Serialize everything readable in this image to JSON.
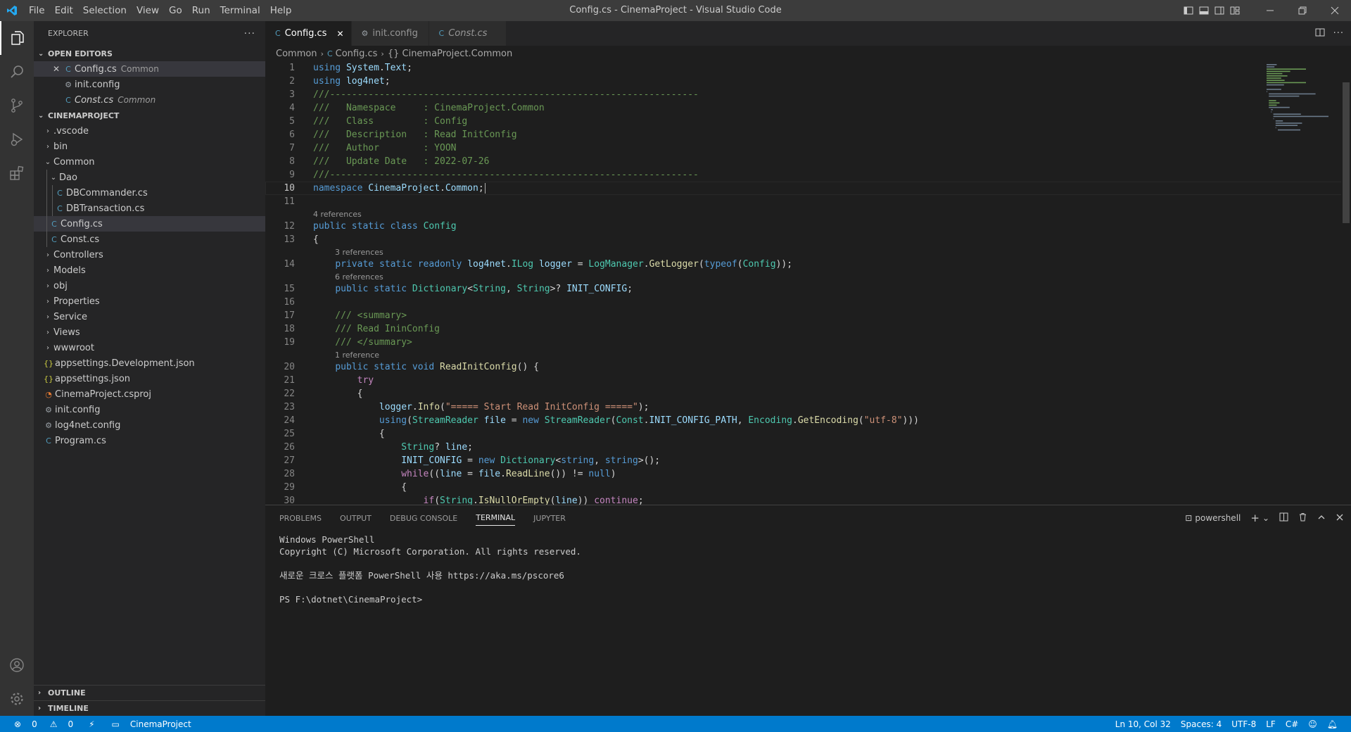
{
  "titlebar": {
    "menu": [
      "File",
      "Edit",
      "Selection",
      "View",
      "Go",
      "Run",
      "Terminal",
      "Help"
    ],
    "title": "Config.cs - CinemaProject - Visual Studio Code"
  },
  "sidebar": {
    "title": "EXPLORER",
    "open_editors": {
      "header": "OPEN EDITORS",
      "items": [
        {
          "name": "Config.cs",
          "desc": "Common"
        },
        {
          "name": "init.config",
          "desc": ""
        },
        {
          "name": "Const.cs",
          "desc": "Common"
        }
      ]
    },
    "project": {
      "header": "CINEMAPROJECT",
      "items": [
        ".vscode",
        "bin",
        "Common",
        "Dao",
        "DBCommander.cs",
        "DBTransaction.cs",
        "Config.cs",
        "Const.cs",
        "Controllers",
        "Models",
        "obj",
        "Properties",
        "Service",
        "Views",
        "wwwroot",
        "appsettings.Development.json",
        "appsettings.json",
        "CinemaProject.csproj",
        "init.config",
        "log4net.config",
        "Program.cs"
      ]
    },
    "outline": "OUTLINE",
    "timeline": "TIMELINE"
  },
  "tabs": [
    {
      "label": "Config.cs",
      "active": true
    },
    {
      "label": "init.config",
      "active": false
    },
    {
      "label": "Const.cs",
      "active": false
    }
  ],
  "breadcrumb": [
    "Common",
    "Config.cs",
    "{} CinemaProject.Common"
  ],
  "lens": {
    "class_refs": "4 references",
    "logger_refs": "3 references",
    "init_config_refs": "6 references",
    "read_refs": "1 reference"
  },
  "code_lines": [
    "using System.Text;",
    "using log4net;",
    "///-------------------------------------------------------------------",
    "///   Namespace     : CinemaProject.Common",
    "///   Class         : Config",
    "///   Description   : Read InitConfig",
    "///   Author        : YOON",
    "///   Update Date   : 2022-07-26",
    "///-------------------------------------------------------------------",
    "namespace CinemaProject.Common;",
    "",
    "public static class Config",
    "{",
    "    private static readonly log4net.ILog logger = LogManager.GetLogger(typeof(Config));",
    "    public static Dictionary<String, String>? INIT_CONFIG;",
    "",
    "    /// <summary>",
    "    /// Read IninConfig",
    "    /// </summary>",
    "    public static void ReadInitConfig() {",
    "        try",
    "        {",
    "            logger.Info(\"===== Start Read InitConfig =====\");",
    "            using(StreamReader file = new StreamReader(Const.INIT_CONFIG_PATH, Encoding.GetEncoding(\"utf-8\")))",
    "            {",
    "                String? line;",
    "                INIT_CONFIG = new Dictionary<string, string>();",
    "                while((line = file.ReadLine()) != null)",
    "                {",
    "                    if(String.IsNullOrEmpty(line)) continue;"
  ],
  "panel": {
    "tabs": [
      "PROBLEMS",
      "OUTPUT",
      "DEBUG CONSOLE",
      "TERMINAL",
      "JUPYTER"
    ],
    "active_tab": "TERMINAL",
    "shell": "powershell",
    "terminal_lines": [
      "Windows PowerShell",
      "Copyright (C) Microsoft Corporation. All rights reserved.",
      "",
      "새로운 크로스 플랫폼 PowerShell 사용 https://aka.ms/pscore6",
      "",
      "PS F:\\dotnet\\CinemaProject>"
    ]
  },
  "statusbar": {
    "errors": "0",
    "warnings": "0",
    "folder": "CinemaProject",
    "position": "Ln 10, Col 32",
    "spaces": "Spaces: 4",
    "encoding": "UTF-8",
    "eol": "LF",
    "language": "C#"
  },
  "colors": {
    "accent": "#007acc",
    "keyword": "#569cd6",
    "type": "#4ec9b0",
    "function": "#dcdcaa",
    "string": "#ce9178",
    "comment": "#6a9955",
    "control": "#c586c0"
  }
}
